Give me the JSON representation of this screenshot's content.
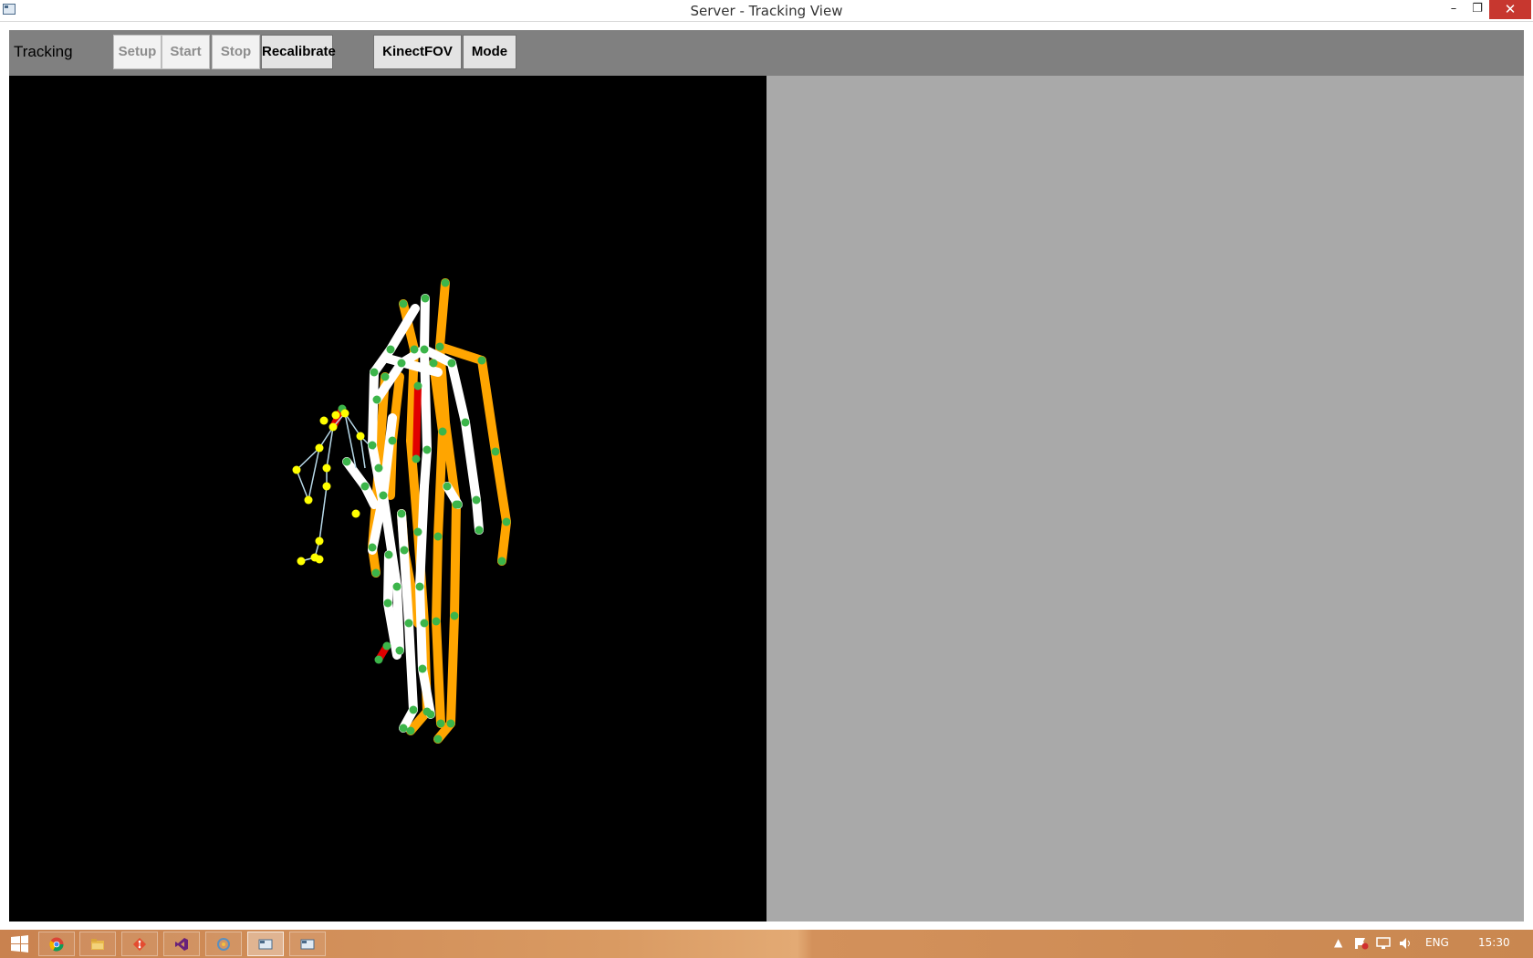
{
  "window": {
    "title": "Server - Tracking View"
  },
  "title_controls": {
    "minimize": "–",
    "maximize": "❐",
    "close": "✕"
  },
  "toolbar": {
    "label": "Tracking",
    "buttons": [
      {
        "label": "Setup",
        "enabled": false
      },
      {
        "label": "Start",
        "enabled": false
      },
      {
        "label": "Stop",
        "enabled": false
      },
      {
        "label": "Recalibrate",
        "enabled": true
      },
      {
        "label": "KinectFOV",
        "enabled": true
      },
      {
        "label": "Mode",
        "enabled": true
      }
    ]
  },
  "colors": {
    "left_view_bg": "#000000",
    "right_view_bg": "#a9a9a9",
    "toolbar_bg": "#808080",
    "bone_white": "#ffffff",
    "bone_orange": "#ffa500",
    "bone_red": "#e00000",
    "joint_green": "#3cb54a",
    "hand_joint_yellow": "#ffff00",
    "hand_bone": "#b7d8e8"
  },
  "taskbar": {
    "items": [
      "chrome-icon",
      "file-explorer-icon",
      "git-icon",
      "visual-studio-icon",
      "app-icon",
      "server-window-icon",
      "server-window-icon-2"
    ],
    "tray": {
      "language": "ENG",
      "time": "15:30"
    }
  }
}
